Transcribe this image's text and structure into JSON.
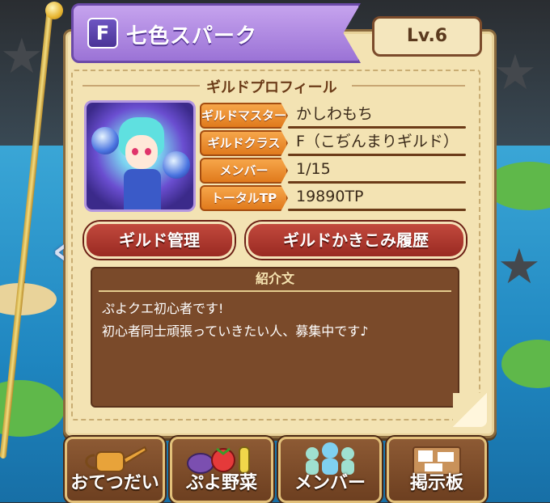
{
  "guild": {
    "grade": "F",
    "name": "七色スパーク",
    "level": "Lv.6"
  },
  "profile": {
    "section_title": "ギルドプロフィール",
    "rows": [
      {
        "label": "ギルドマスター",
        "value": "かしわもち"
      },
      {
        "label": "ギルドクラス",
        "value": "F（こぢんまりギルド）"
      },
      {
        "label": "メンバー",
        "value": "1/15"
      },
      {
        "label": "トータルTP",
        "value": "19890TP"
      }
    ]
  },
  "actions": {
    "manage_label": "ギルド管理",
    "history_label": "ギルドかきこみ履歴"
  },
  "intro": {
    "title": "紹介文",
    "lines": [
      "ぷよクエ初心者です!",
      "初心者同士頑張っていきたい人、募集中です♪"
    ]
  },
  "nav": [
    {
      "label": "おてつだい",
      "icon": "watering-can-icon"
    },
    {
      "label": "ぷよ野菜",
      "icon": "vegetables-icon"
    },
    {
      "label": "メンバー",
      "icon": "members-icon"
    },
    {
      "label": "掲示板",
      "icon": "bulletin-board-icon"
    }
  ],
  "icons": {
    "left_arrow": "chevron-left-icon"
  },
  "colors": {
    "banner": "#9b73d6",
    "label_orange": "#e07a1c",
    "action_red": "#9a2a22",
    "parchment": "#f3e3b3",
    "intro_bg": "#7a4a2a"
  }
}
